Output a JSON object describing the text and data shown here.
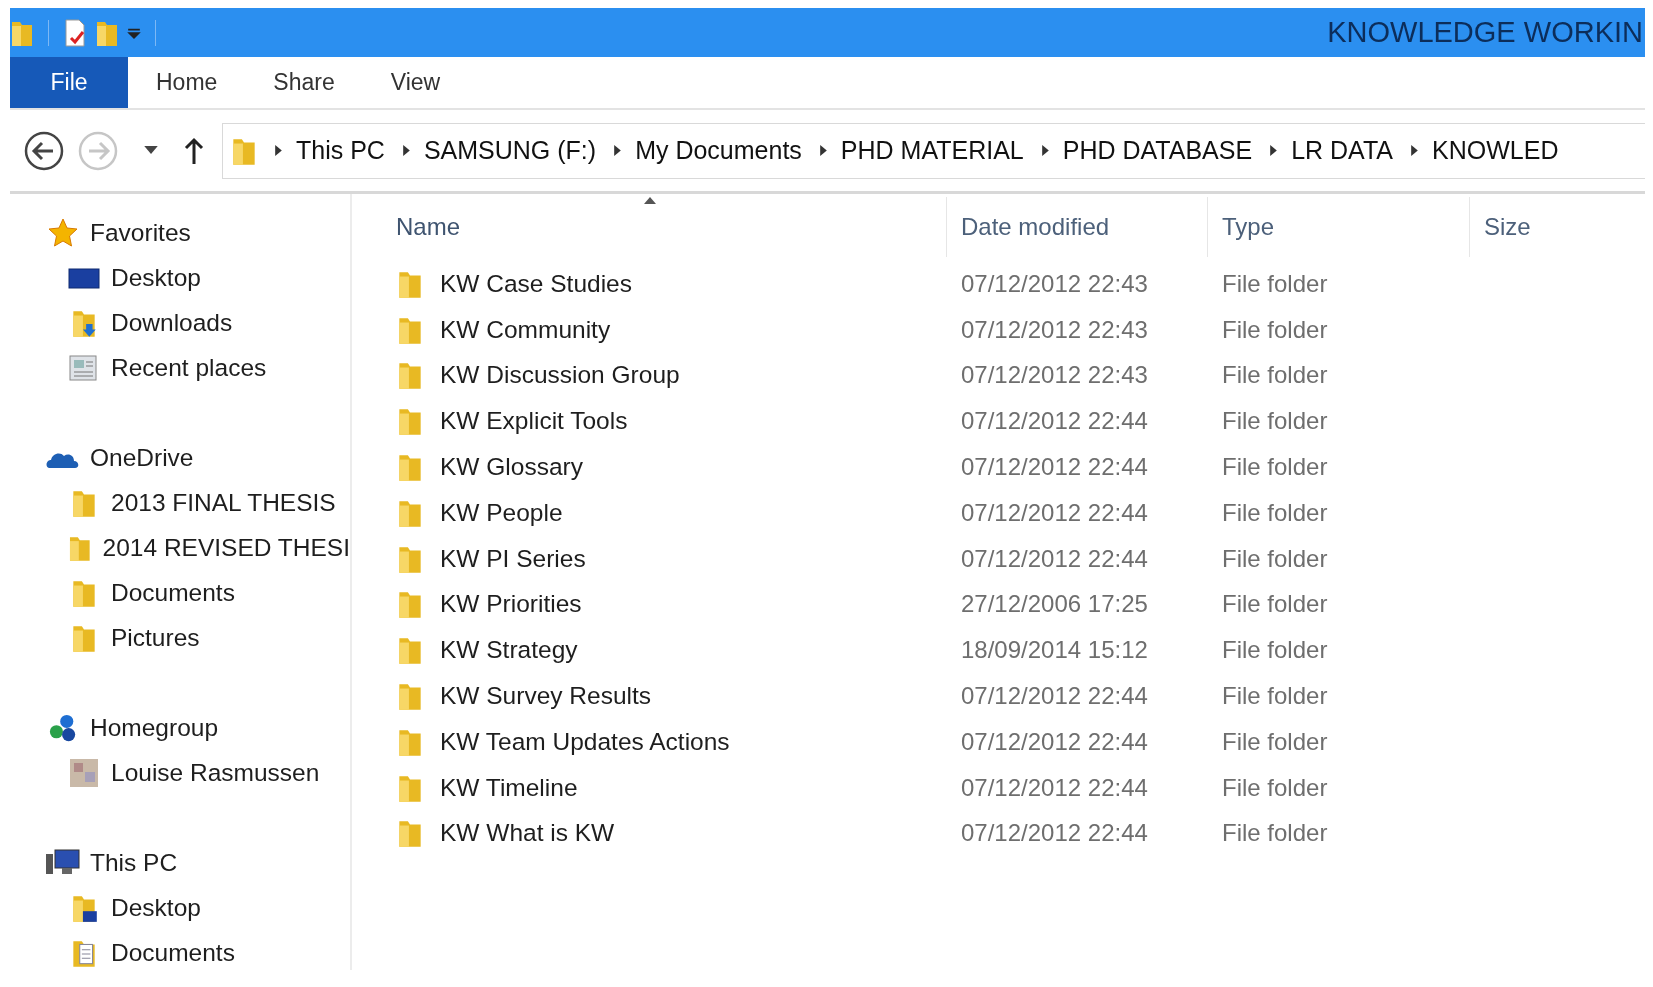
{
  "window": {
    "title": "KNOWLEDGE WORKIN"
  },
  "ribbon_tabs": [
    {
      "label": "File",
      "kind": "file"
    },
    {
      "label": "Home",
      "kind": "tab"
    },
    {
      "label": "Share",
      "kind": "tab"
    },
    {
      "label": "View",
      "kind": "tab"
    }
  ],
  "navigation": {
    "back_disabled": false,
    "forward_disabled": true
  },
  "address_bar": {
    "breadcrumbs": [
      "This PC",
      "SAMSUNG (F:)",
      "My Documents",
      "PHD MATERIAL",
      "PHD DATABASE",
      "LR DATA",
      "KNOWLED"
    ]
  },
  "sidebar": {
    "groups": [
      {
        "label": "Favorites",
        "kind": "favorites",
        "items": [
          {
            "label": "Desktop",
            "kind": "desktop"
          },
          {
            "label": "Downloads",
            "kind": "downloads"
          },
          {
            "label": "Recent places",
            "kind": "recent"
          }
        ]
      },
      {
        "label": "OneDrive",
        "kind": "onedrive",
        "items": [
          {
            "label": "2013 FINAL THESIS",
            "kind": "folder"
          },
          {
            "label": "2014 REVISED THESI",
            "kind": "folder"
          },
          {
            "label": "Documents",
            "kind": "folder"
          },
          {
            "label": "Pictures",
            "kind": "folder"
          }
        ]
      },
      {
        "label": "Homegroup",
        "kind": "homegroup",
        "items": [
          {
            "label": "Louise Rasmussen",
            "kind": "user"
          }
        ]
      },
      {
        "label": "This PC",
        "kind": "pc",
        "items": [
          {
            "label": "Desktop",
            "kind": "pc-desktop"
          },
          {
            "label": "Documents",
            "kind": "documents"
          }
        ]
      }
    ]
  },
  "file_list": {
    "columns": [
      {
        "label": "Name",
        "sorted": true
      },
      {
        "label": "Date modified",
        "sorted": false
      },
      {
        "label": "Type",
        "sorted": false
      },
      {
        "label": "Size",
        "sorted": false
      }
    ],
    "rows": [
      {
        "name": "KW Case Studies",
        "date_modified": "07/12/2012 22:43",
        "type": "File folder"
      },
      {
        "name": "KW Community",
        "date_modified": "07/12/2012 22:43",
        "type": "File folder"
      },
      {
        "name": "KW Discussion Group",
        "date_modified": "07/12/2012 22:43",
        "type": "File folder"
      },
      {
        "name": "KW Explicit Tools",
        "date_modified": "07/12/2012 22:44",
        "type": "File folder"
      },
      {
        "name": "KW Glossary",
        "date_modified": "07/12/2012 22:44",
        "type": "File folder"
      },
      {
        "name": "KW People",
        "date_modified": "07/12/2012 22:44",
        "type": "File folder"
      },
      {
        "name": "KW PI Series",
        "date_modified": "07/12/2012 22:44",
        "type": "File folder"
      },
      {
        "name": "KW Priorities",
        "date_modified": "27/12/2006 17:25",
        "type": "File folder"
      },
      {
        "name": "KW Strategy",
        "date_modified": "18/09/2014 15:12",
        "type": "File folder"
      },
      {
        "name": "KW Survey Results",
        "date_modified": "07/12/2012 22:44",
        "type": "File folder"
      },
      {
        "name": "KW Team Updates Actions",
        "date_modified": "07/12/2012 22:44",
        "type": "File folder"
      },
      {
        "name": "KW Timeline",
        "date_modified": "07/12/2012 22:44",
        "type": "File folder"
      },
      {
        "name": "KW What is KW",
        "date_modified": "07/12/2012 22:44",
        "type": "File folder"
      }
    ]
  }
}
